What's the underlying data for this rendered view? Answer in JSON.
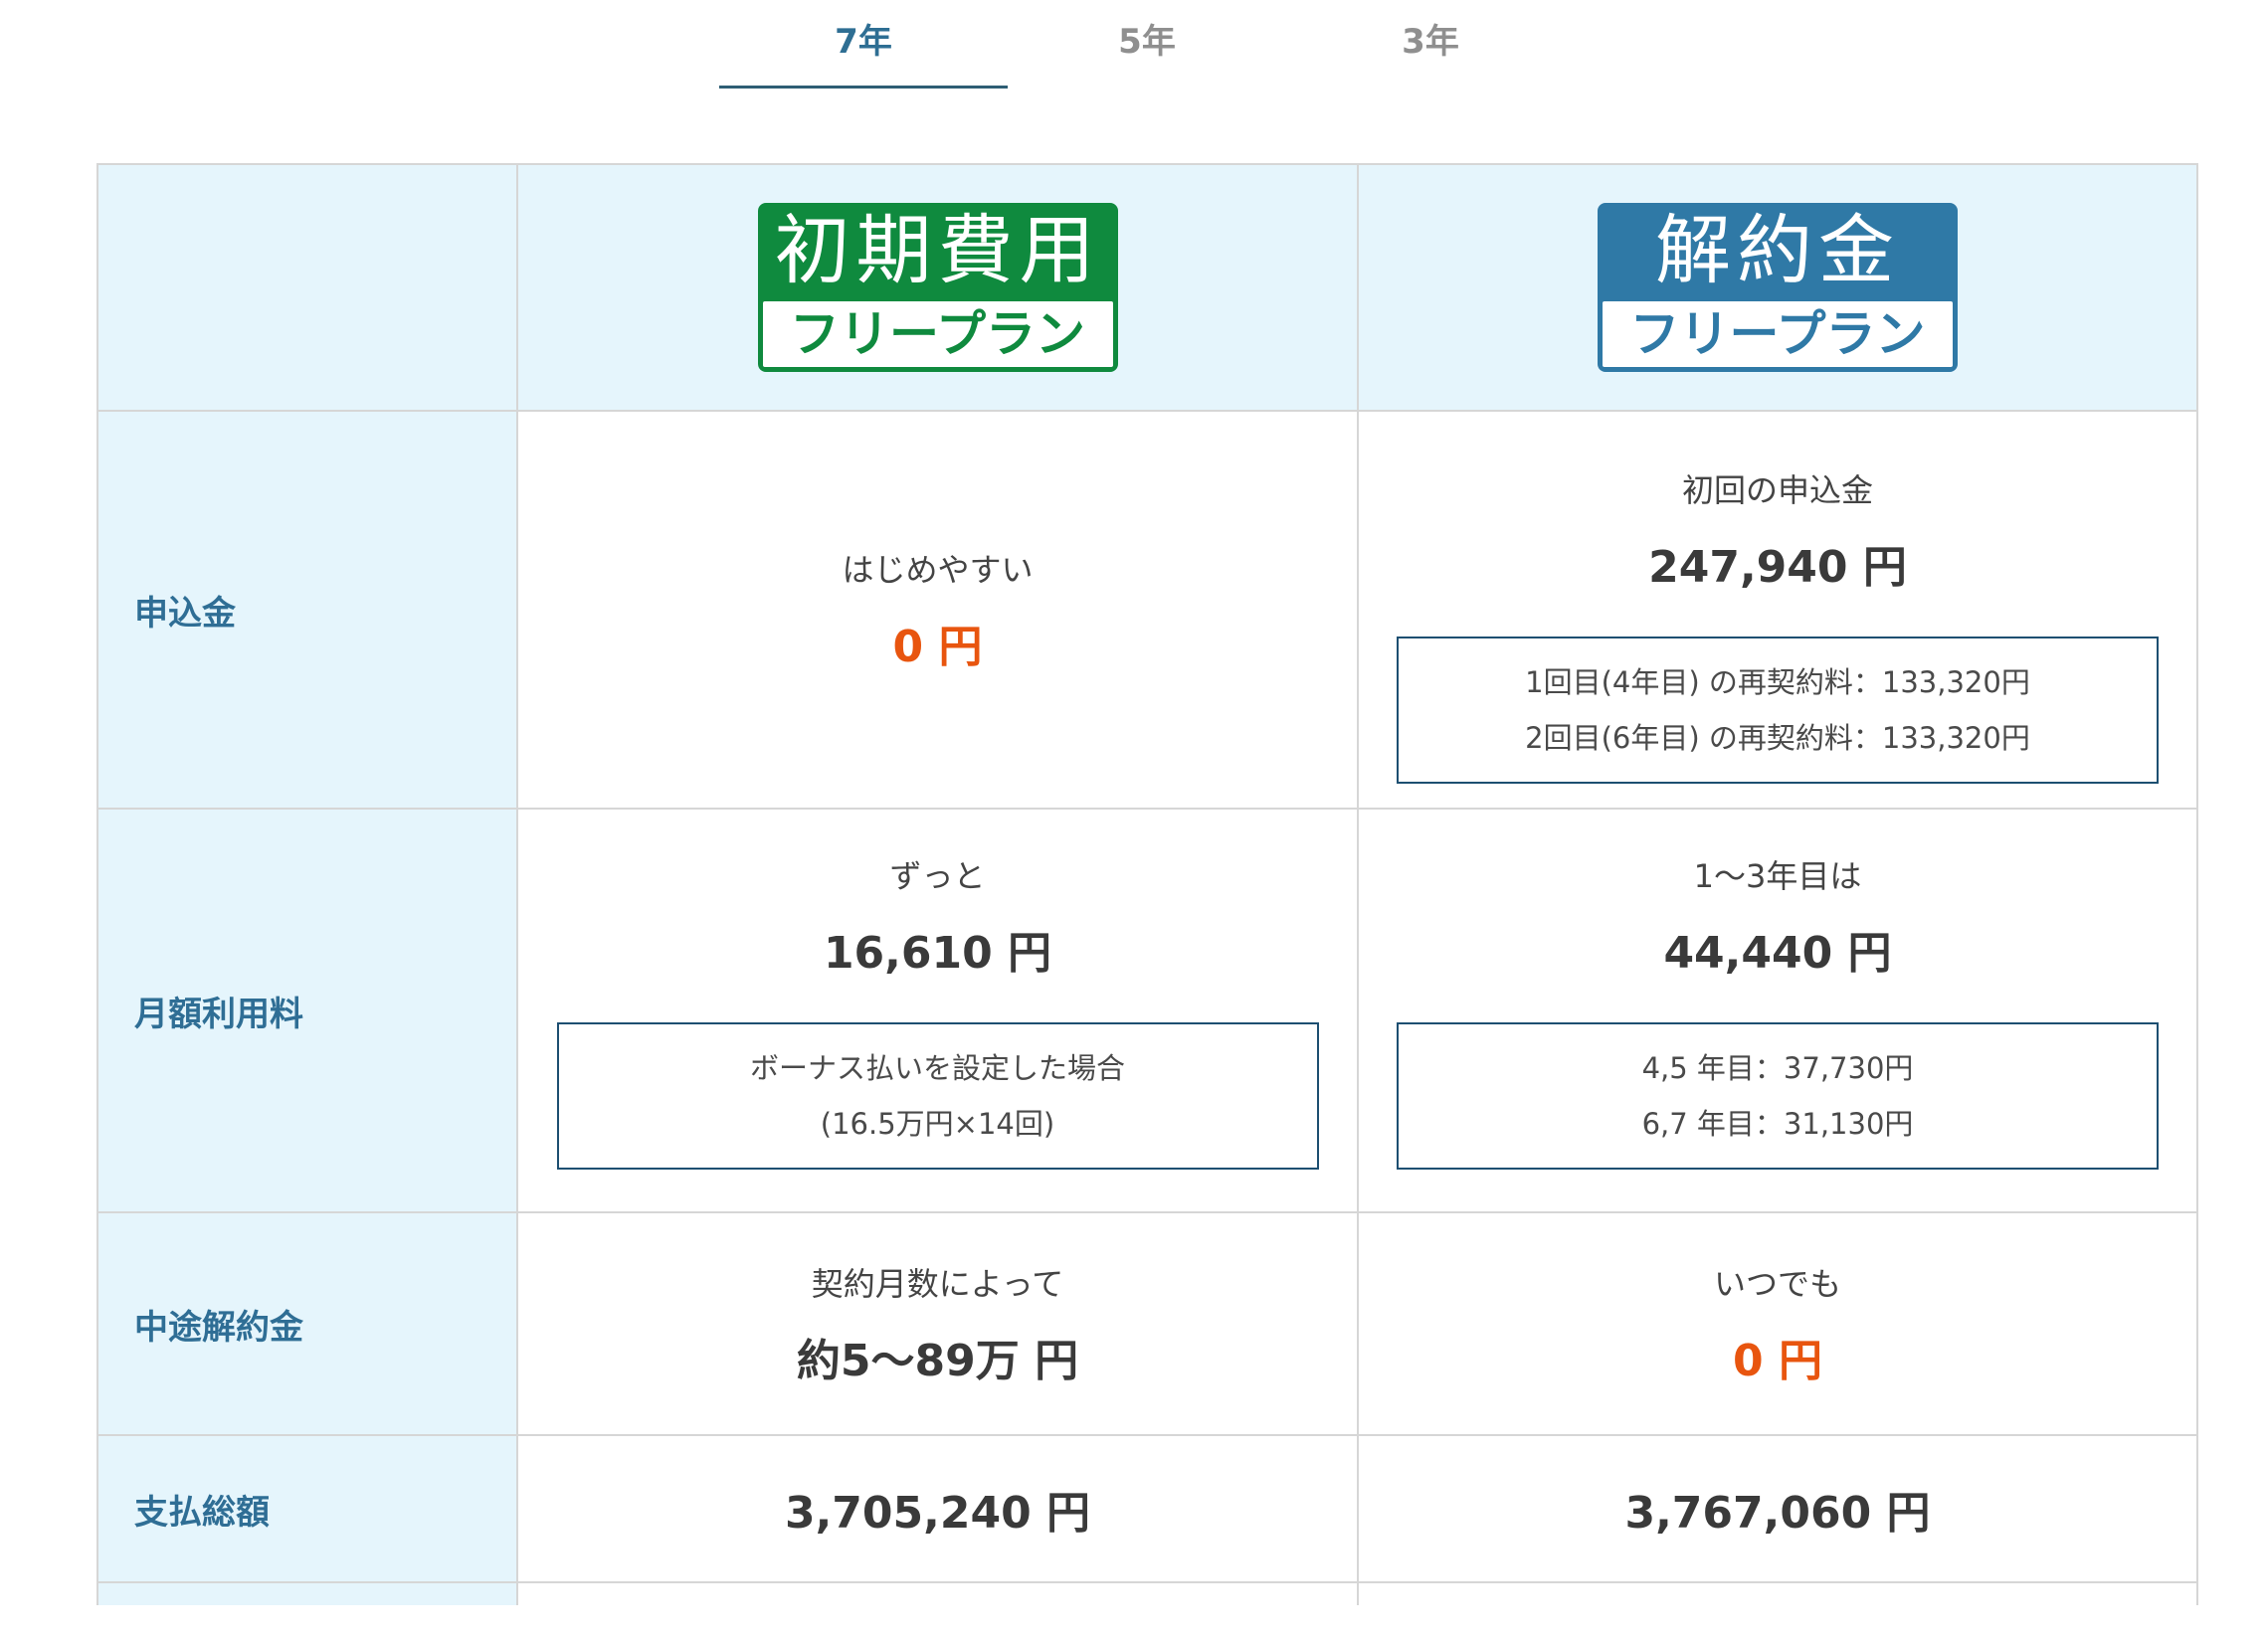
{
  "tabs": [
    {
      "label": "7年",
      "active": true
    },
    {
      "label": "5年",
      "active": false
    },
    {
      "label": "3年",
      "active": false
    }
  ],
  "plans": {
    "initial_free": {
      "badge_top": "初期費用",
      "badge_bottom": "フリープラン",
      "color": "#0f8a3e"
    },
    "cancel_free": {
      "badge_top": "解約金",
      "badge_bottom": "フリープラン",
      "color": "#2f79a6"
    }
  },
  "rows": {
    "application_fee": {
      "label": "申込金",
      "initial_free": {
        "lead": "はじめやすい",
        "amount": "0 円"
      },
      "cancel_free": {
        "lead": "初回の申込金",
        "amount": "247,940 円",
        "notes": [
          "1回目(4年目) の再契約料：133,320円",
          "2回目(6年目) の再契約料：133,320円"
        ]
      }
    },
    "monthly_fee": {
      "label": "月額利用料",
      "initial_free": {
        "lead": "ずっと",
        "amount": "16,610 円",
        "notes": [
          "ボーナス払いを設定した場合",
          "(16.5万円×14回)"
        ]
      },
      "cancel_free": {
        "lead": "1〜3年目は",
        "amount": "44,440 円",
        "notes": [
          "4,5 年目：37,730円",
          "6,7 年目：31,130円"
        ]
      }
    },
    "cancellation_fee": {
      "label": "中途解約金",
      "initial_free": {
        "lead": "契約月数によって",
        "amount": "約5〜89万 円"
      },
      "cancel_free": {
        "lead": "いつでも",
        "amount": "0 円"
      }
    },
    "total": {
      "label": "支払総額",
      "initial_free": {
        "amount": "3,705,240 円"
      },
      "cancel_free": {
        "amount": "3,767,060 円"
      }
    }
  },
  "colors": {
    "accent": "#2f6e95",
    "highlight": "#e8550f",
    "header_bg": "#e5f5fc",
    "note_border": "#1d4f71"
  }
}
